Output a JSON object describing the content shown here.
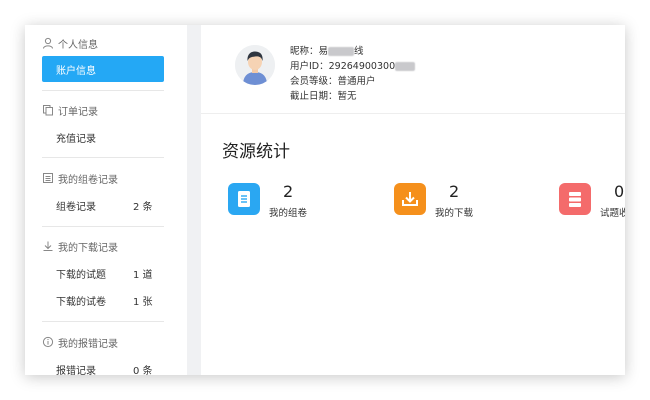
{
  "sidebar": {
    "groups": [
      {
        "title": "个人信息",
        "icon": "user-icon",
        "items": [
          {
            "label": "账户信息",
            "count": ""
          }
        ]
      },
      {
        "title": "订单记录",
        "icon": "copy-icon",
        "items": [
          {
            "label": "充值记录",
            "count": ""
          }
        ]
      },
      {
        "title": "我的组卷记录",
        "icon": "list-icon",
        "items": [
          {
            "label": "组卷记录",
            "count": "2 条"
          }
        ]
      },
      {
        "title": "我的下载记录",
        "icon": "download-icon",
        "items": [
          {
            "label": "下载的试题",
            "count": "1 道"
          },
          {
            "label": "下载的试卷",
            "count": "1 张"
          }
        ]
      },
      {
        "title": "我的报错记录",
        "icon": "info-icon",
        "items": [
          {
            "label": "报错记录",
            "count": "0 条"
          }
        ]
      }
    ]
  },
  "profile": {
    "nickname_label": "昵称：",
    "nickname_partial": "易",
    "nickname_tail": "线",
    "user_id_label": "用户ID：",
    "user_id_partial": "29264900300",
    "level_label": "会员等级：",
    "level_value": "普通用户",
    "expire_label": "截止日期：",
    "expire_value": "暂无"
  },
  "stats": {
    "title": "资源统计",
    "cards": [
      {
        "value": "2",
        "label": "我的组卷",
        "color": "#2aa7f2",
        "icon": "document-icon"
      },
      {
        "value": "2",
        "label": "我的下载",
        "color": "#f5901c",
        "icon": "download-box-icon"
      },
      {
        "value": "0",
        "label": "试题收藏",
        "color": "#f46b6b",
        "icon": "stack-icon"
      }
    ]
  }
}
